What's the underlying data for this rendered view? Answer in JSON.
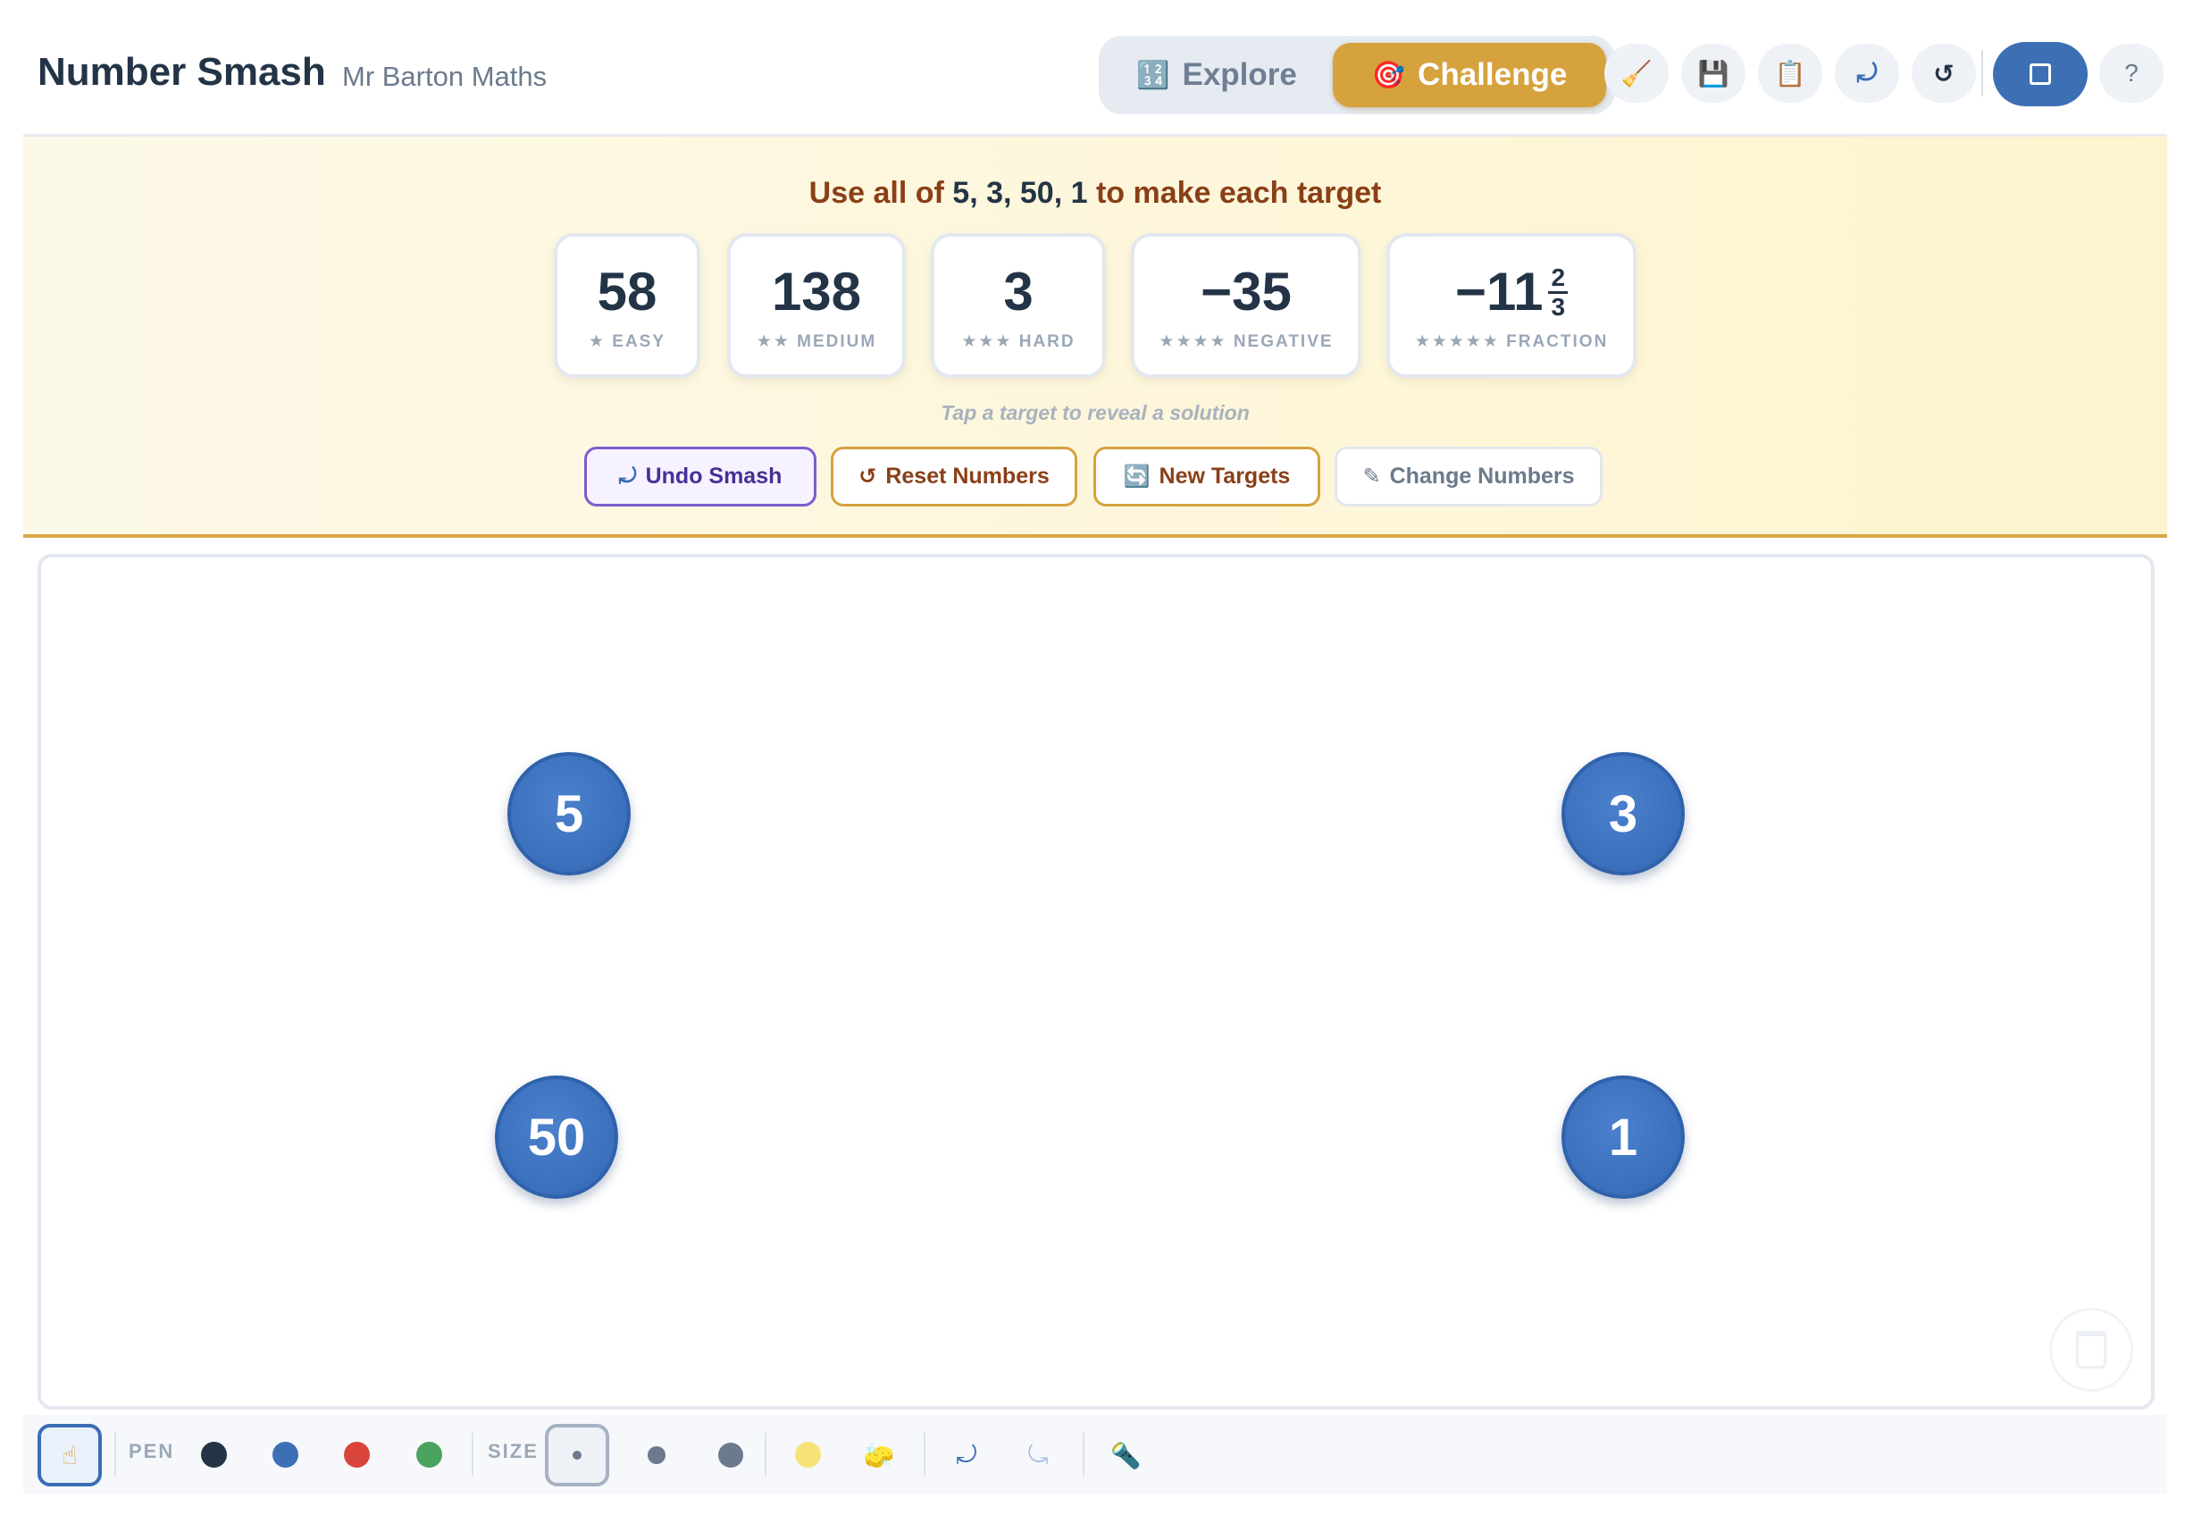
{
  "header": {
    "title": "Number Smash",
    "subtitle": "Mr Barton Maths",
    "modes": [
      {
        "label": "Explore",
        "icon": "🔢",
        "active": false
      },
      {
        "label": "Challenge",
        "icon": "🎯",
        "active": true
      }
    ],
    "tools": [
      {
        "name": "clear-icon",
        "glyph": "🧹"
      },
      {
        "name": "save-icon",
        "glyph": "💾"
      },
      {
        "name": "clipboard-icon",
        "glyph": "📋"
      },
      {
        "name": "undo-icon",
        "glyph": "⤾"
      },
      {
        "name": "reset-icon",
        "glyph": "↺"
      }
    ],
    "help_label": "?"
  },
  "challenge": {
    "instruction_prefix": "Use all of",
    "instruction_numbers": "5, 3, 50, 1",
    "instruction_suffix": "to make each target",
    "targets": [
      {
        "value": "58",
        "stars": "★",
        "level": "EASY",
        "label": "★ EASY"
      },
      {
        "value": "138",
        "stars": "★★",
        "level": "MEDIUM",
        "label": "★★ MEDIUM"
      },
      {
        "value": "3",
        "stars": "★★★",
        "level": "HARD",
        "label": "★★★ HARD"
      },
      {
        "value": "−35",
        "stars": "★★★★",
        "level": "NEGATIVE",
        "label": "★★★★ NEGATIVE"
      },
      {
        "value_whole": "−11",
        "value_num": "2",
        "value_den": "3",
        "stars": "★★★★★",
        "level": "FRACTION",
        "label": "★★★★★ FRACTION"
      }
    ],
    "hint": "Tap a target to reveal a solution",
    "buttons": {
      "undo": {
        "icon": "⤾",
        "label": "Undo Smash"
      },
      "reset": {
        "icon": "↺",
        "label": "Reset Numbers"
      },
      "new_targets": {
        "icon": "🔄",
        "label": "New Targets"
      },
      "change": {
        "icon": "✎",
        "label": "Change Numbers"
      }
    }
  },
  "canvas": {
    "numbers": [
      "5",
      "3",
      "50",
      "1"
    ],
    "trash_icon": "trash-icon"
  },
  "draw_toolbar": {
    "pointer_icon": "☝",
    "pen_label": "PEN",
    "pen_colors": [
      "#243447",
      "#3d6fb4",
      "#d9453b",
      "#4aa35f"
    ],
    "size_label": "SIZE",
    "highlighter_color": "#f7e27a",
    "eraser_glyph": "🧽",
    "undo_glyph": "⤾",
    "redo_glyph": "⤿",
    "laser_glyph": "🔦"
  },
  "colors": {
    "accent": "#d6a23d",
    "primary_blue": "#3d6fb4",
    "instruction_brown": "#8a3f17"
  }
}
